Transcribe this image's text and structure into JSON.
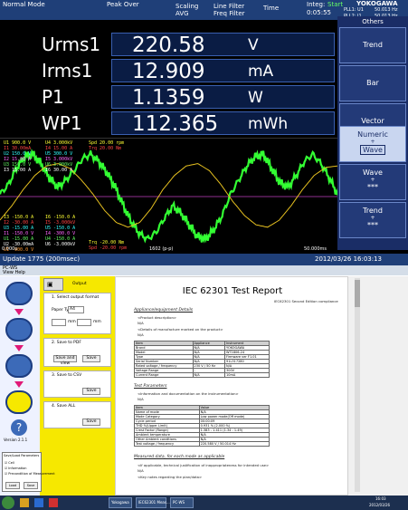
{
  "instrument": {
    "topbar": {
      "mode": "Normal Mode",
      "peak": "Peak Over",
      "scaling": "Scaling",
      "avg": "AVG",
      "line_filter": "Line Filter",
      "freq_filter": "Freq Filter",
      "time_label": "Time",
      "time_value": "0:05:55",
      "integ_label": "Integ:",
      "integ_state": "Start",
      "brand": "YOKOGAWA",
      "pll1": "PLL1: U1",
      "pll1_val": "50.013 Hz",
      "pll2": "PLL2: I1",
      "pll2_val": "50.013 Hz"
    },
    "numeric": [
      {
        "label": "Urms1",
        "value": "220.58",
        "unit": "V"
      },
      {
        "label": "Irms1",
        "value": "12.909",
        "unit": "mA"
      },
      {
        "label": "P1",
        "value": "1.1359",
        "unit": "W"
      },
      {
        "label": "WP1",
        "value": "112.365",
        "unit": "mWh"
      }
    ],
    "side_menu": {
      "header": "Others",
      "items": [
        "Trend",
        "Bar",
        "Vector",
        "Numeric",
        "Wave",
        "Trend"
      ],
      "numeric_sub": "Wave",
      "wave_sub": "***",
      "trend_sub": "***"
    },
    "channels_left": [
      "U1  900.0 V",
      "I1  30.00mA",
      "U2  150.0 V",
      "I2  15.00 A",
      "U3  150.0 V",
      "I3  15.00 A"
    ],
    "channels_mid": [
      "U4  3.000kV",
      "I4  15.00 A",
      "U5  300.0 V",
      "I5  3.000kV",
      "U6  3.000kV",
      "I6  30.00 A"
    ],
    "channels_right": [
      "Spd  20.00 rpm",
      "Trq  20.00 Nm"
    ],
    "channels_left_bot": [
      "I3  -150.0 A",
      "I2  -30.00 A",
      "U3  -15.00 A",
      "I1  -150.0 V",
      "U1  -15.00 A",
      "U2  -30.00mA",
      "U1  -900.0 V"
    ],
    "channels_mid_bot": [
      "I6  -150.0 A",
      "I5  -3.000kV",
      "U5  -150.0 A",
      "I4  -300.0 V",
      "U4  -150.0 A",
      "U6  -3.000kV"
    ],
    "channels_right_bot": [
      "Trq  -20.00 Nm",
      "Spd  -20.00 rpm"
    ],
    "x_start": "0.000s",
    "x_end": "50.000ms",
    "x_center": "1602 (p-p)",
    "bottombar": {
      "update": "Update 1775 (200msec)",
      "datetime": "2012/03/26 16:03:13"
    },
    "colors": {
      "u1": "#33ff33",
      "i1": "#e6c020",
      "ref": "#c040c0"
    },
    "wave_data": {
      "u1": [
        0.05,
        0.25,
        0.6,
        0.85,
        0.9,
        0.7,
        0.4,
        0.2,
        0.35,
        0.55,
        0.8,
        0.9,
        0.75,
        0.5,
        0.2,
        -0.2,
        -0.55,
        -0.8,
        -0.9,
        -0.75,
        -0.45,
        -0.2,
        -0.35,
        -0.6,
        -0.85,
        -0.9,
        -0.7,
        -0.4,
        0.05,
        0.35,
        0.65,
        0.85,
        0.9,
        0.6,
        0.3,
        0.2,
        0.45,
        0.75,
        0.9,
        0.7,
        0.4,
        0.05
      ],
      "i1": [
        -0.5,
        -0.2,
        0.15,
        0.45,
        0.65,
        0.7,
        0.6,
        0.35,
        0.05,
        -0.3,
        -0.55,
        -0.65,
        -0.55,
        -0.25,
        0.15,
        0.45,
        0.65,
        0.7,
        0.55,
        0.25,
        -0.1,
        -0.4,
        -0.6,
        -0.65,
        -0.5,
        -0.2,
        0.15,
        0.45,
        0.62,
        0.65
      ]
    }
  },
  "pc": {
    "app_title": "PC-WS",
    "menu": "View  Help",
    "ypanel": {
      "tab": "Output",
      "sec1": "1. Select output format",
      "paper_type_label": "Paper Type",
      "paper_type_value": "A4",
      "unit_label": "mm",
      "sec2": "2. Save to PDF",
      "save_and_view": "Save and view",
      "save": "Save",
      "sec3": "3. Save to CSV",
      "sec4": "4. Save ALL",
      "version": "Version 2.1.1",
      "params_title": "Save/Load Parameters",
      "check_cell": "Cell",
      "check_info": "Information",
      "check_prec": "Precondition of Measurement",
      "load": "Load",
      "save_small": "Save"
    },
    "doc": {
      "title": "IEC 62301 Test Report",
      "edition": "IEC62301 Second Edition compliance",
      "appliance_heading": "Appliance/equipment Details",
      "product_desc": "<Product description>",
      "na": "N/A",
      "details_mfr": "<Details of manufacture marked on the product>",
      "table1_header": [
        "Item",
        "Appliance",
        "Instrument"
      ],
      "table1_rows": [
        [
          "Brand",
          "N/A",
          "YOKOGAWA"
        ],
        [
          "Model",
          "N/A",
          "WT1806-24"
        ],
        [
          "Type",
          "N/A",
          "Firmware ver F1.01"
        ],
        [
          "Serial Number",
          "N/A",
          "91L317280"
        ],
        [
          "Rated voltage / frequency",
          "230 V / 50 Hz",
          "N/A"
        ],
        [
          "Voltage Range",
          "-",
          "300V"
        ],
        [
          "Current Range",
          "N/A",
          "10mA"
        ]
      ],
      "test_params": "Test Parameters",
      "test_info": "<Information and documentation on the instrumentation>",
      "table2_header": [
        "Item",
        "Value"
      ],
      "table2_rows": [
        [
          "Name of mode",
          "N/A"
        ],
        [
          "Mode Category",
          "Low power mode(Off mode)"
        ],
        [
          "Cycle period",
          "00:00:09"
        ],
        [
          "THD    %(Upper Limit)",
          "0.931 % (2.000 %)"
        ],
        [
          "Crest Factor (Range)",
          "1.383 - 1.411 (1.34 - 1.49)"
        ],
        [
          "Ambient temperature",
          "N/A"
        ],
        [
          "Other Ambient conditions",
          "N/A"
        ],
        [
          "Test voltage / frequency",
          "220.580 V / 50.014 Hz"
        ]
      ],
      "measured": "Measured data, for each mode as applicable",
      "applicable": "<If applicable, technical justification of inappropriateness for intended use>",
      "key_notes": "<Key notes regarding the plan/data>"
    },
    "taskbar": {
      "items": [
        "Yokogawa",
        "IEC62301 Meas...",
        "PC-WS"
      ],
      "clock": "16:03",
      "date": "2012/03/26"
    }
  }
}
